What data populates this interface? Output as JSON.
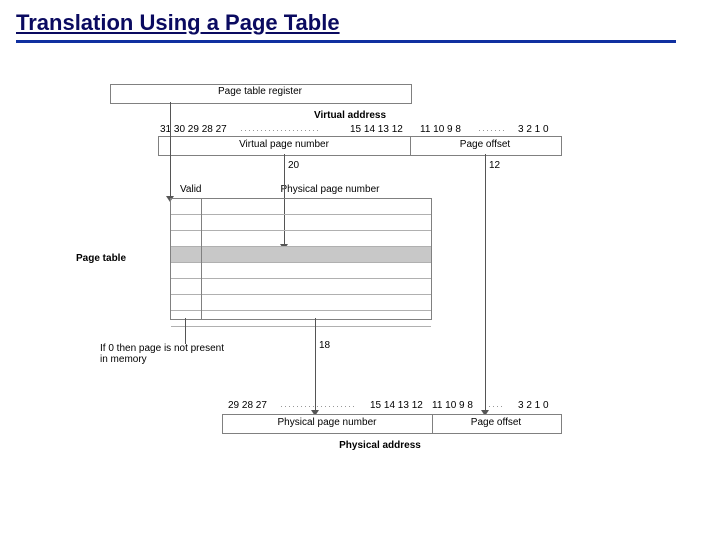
{
  "title": "Translation Using a Page Table",
  "registerLabel": "Page table register",
  "virtualAddressLabel": "Virtual address",
  "vaBitsLeft": "31 30 29 28 27",
  "vaBitsMid": "15 14 13 12",
  "vaBitsRight1": "11 10 9 8",
  "vaBitsRight2": "3 2 1 0",
  "vpnLabel": "Virtual page number",
  "pageOffsetLabel": "Page offset",
  "vpnWidth": "20",
  "offsetWidth": "12",
  "validLabel": "Valid",
  "ppnColumnLabel": "Physical page number",
  "pageTableLabel": "Page table",
  "notPresentLabel": "If 0 then page is not present in memory",
  "ppnWidth": "18",
  "paBitsLeft": "29 28 27",
  "paBitsMid": "15 14 13 12",
  "paBitsRight1": "11 10 9 8",
  "paBitsRight2": "3 2 1 0",
  "ppnLabel": "Physical page number",
  "physicalAddressLabel": "Physical address"
}
